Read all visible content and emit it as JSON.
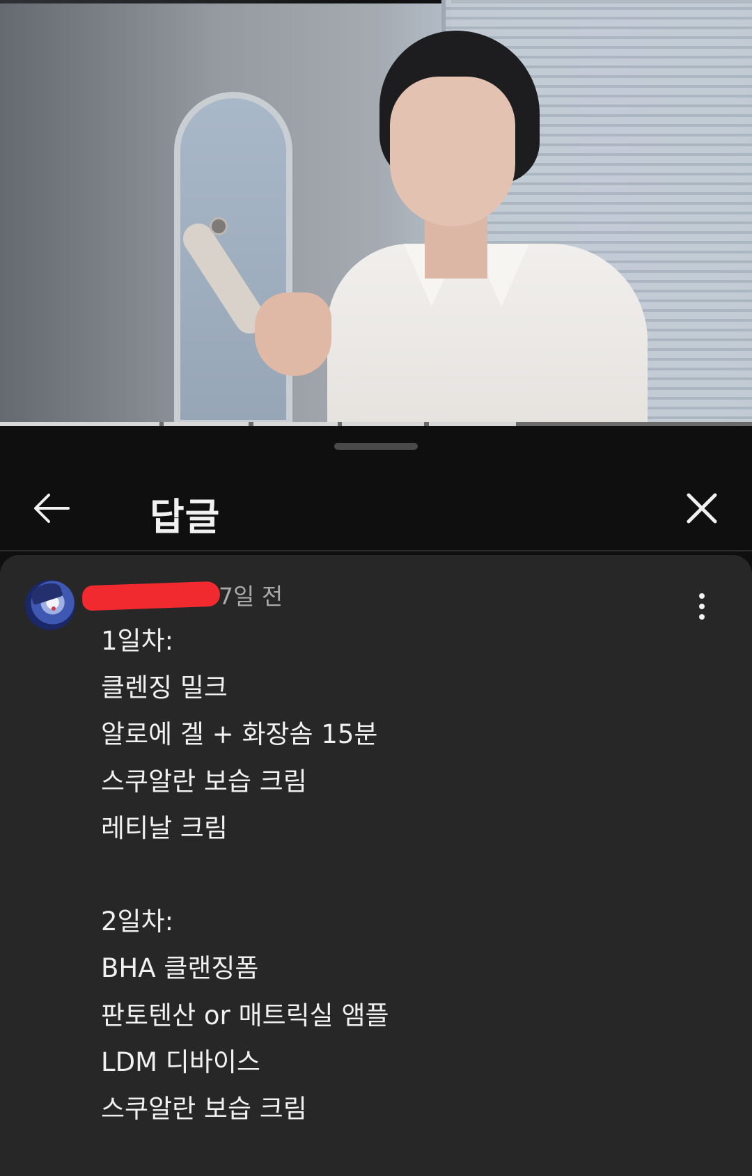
{
  "video": {
    "seek_segments": [
      {
        "start": 0,
        "end": 0.212
      },
      {
        "start": 0.218,
        "end": 0.331
      },
      {
        "start": 0.337,
        "end": 0.449
      },
      {
        "start": 0.455,
        "end": 0.564
      },
      {
        "start": 0.57,
        "end": 0.686
      }
    ]
  },
  "sheet": {
    "title": "답글",
    "back_icon": "arrow-left-icon",
    "close_icon": "close-icon"
  },
  "comment": {
    "time": "7일 전",
    "author_redacted": true,
    "more_icon": "more-vert-icon",
    "lines": [
      "1일차:",
      "클렌징 밀크",
      "알로에 겔 + 화장솜 15분",
      "스쿠알란 보습 크림",
      "레티날 크림",
      "",
      "2일차:",
      "BHA 클랜징폼",
      "판토텐산 or 매트릭실 앰플",
      "LDM 디바이스",
      "스쿠알란 보습 크림"
    ]
  },
  "colors": {
    "background": "#0f0f0f",
    "card": "#272727",
    "text": "#f1f1f1",
    "meta_text": "#aaaaaa",
    "redaction": "#f12a2f"
  }
}
